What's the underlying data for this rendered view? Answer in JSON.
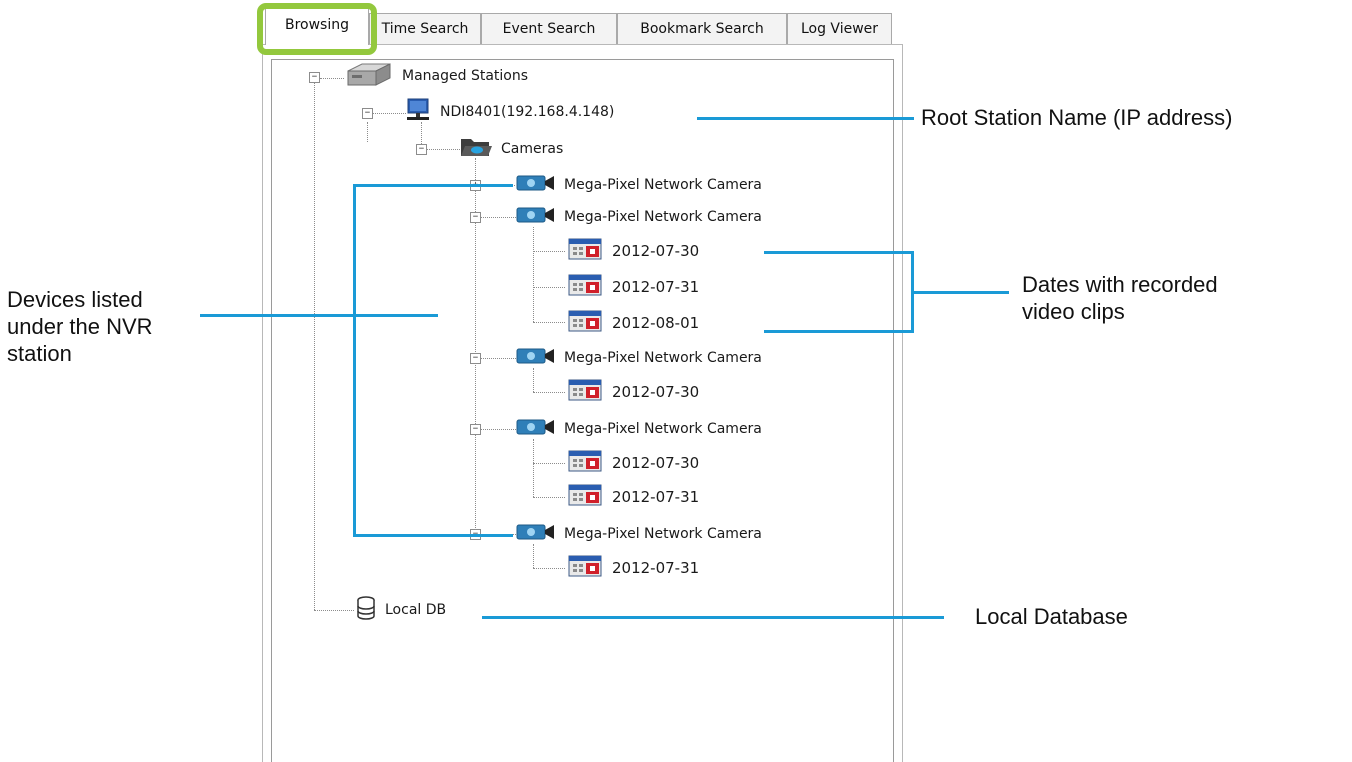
{
  "tabs": [
    {
      "label": "Browsing",
      "active": true
    },
    {
      "label": "Time Search",
      "active": false
    },
    {
      "label": "Event Search",
      "active": false
    },
    {
      "label": "Bookmark Search",
      "active": false
    },
    {
      "label": "Log Viewer",
      "active": false
    }
  ],
  "tree": {
    "root_label": "Managed Stations",
    "station_label": "NDI8401(192.168.4.148)",
    "cameras_folder_label": "Cameras",
    "cameras": [
      {
        "label": "Mega-Pixel Network Camera",
        "expanded": false,
        "dates": []
      },
      {
        "label": "Mega-Pixel Network Camera",
        "expanded": true,
        "dates": [
          "2012-07-30",
          "2012-07-31",
          "2012-08-01"
        ]
      },
      {
        "label": "Mega-Pixel Network Camera",
        "expanded": true,
        "dates": [
          "2012-07-30"
        ]
      },
      {
        "label": "Mega-Pixel Network Camera",
        "expanded": true,
        "dates": [
          "2012-07-30",
          "2012-07-31"
        ]
      },
      {
        "label": "Mega-Pixel Network Camera",
        "expanded": true,
        "dates": [
          "2012-07-31"
        ]
      }
    ],
    "local_db_label": "Local DB",
    "icons": {
      "root": "server-icon",
      "station": "computer-icon",
      "folder": "folder-icon",
      "camera": "camera-icon",
      "date": "calendar-icon",
      "database": "database-icon"
    }
  },
  "annotations": {
    "root_station": "Root Station Name (IP address)",
    "devices": [
      "Devices listed",
      "under the NVR",
      "station"
    ],
    "dates": [
      "Dates with recorded",
      "video clips"
    ],
    "local_db": "Local Database"
  },
  "colors": {
    "highlight": "#93c83d",
    "callout_line": "#1a9ad6",
    "calendar_red": "#d0202a"
  }
}
